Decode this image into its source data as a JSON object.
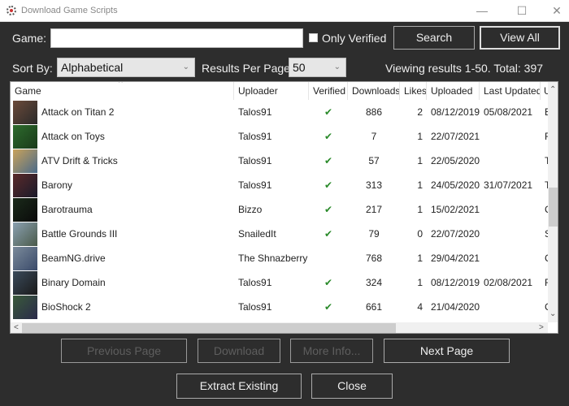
{
  "window": {
    "title": "Download Game Scripts",
    "controls": {
      "minimize": "—",
      "maximize": "☐",
      "close": "✕"
    }
  },
  "search": {
    "game_label": "Game:",
    "game_value": "",
    "only_verified_label": "Only Verified",
    "only_verified_checked": false,
    "search_button": "Search",
    "view_all_button": "View All"
  },
  "sort": {
    "label": "Sort By:",
    "value": "Alphabetical",
    "per_page_label": "Results Per Page:",
    "per_page_value": "50",
    "status": "Viewing results 1-50. Total: 397"
  },
  "table": {
    "columns": [
      "Game",
      "Uploader",
      "Verified",
      "Downloads",
      "Likes",
      "Uploaded",
      "Last Updated",
      "U"
    ],
    "sort_column": "Game",
    "check_glyph": "✔",
    "rows": [
      {
        "game": "Attack on Titan 2",
        "uploader": "Talos91",
        "verified": true,
        "downloads": "886",
        "likes": "2",
        "uploaded": "08/12/2019",
        "updated": "05/08/2021",
        "extra": "E",
        "thumb": [
          "#6b4a3a",
          "#2a2a2a"
        ]
      },
      {
        "game": "Attack on Toys",
        "uploader": "Talos91",
        "verified": true,
        "downloads": "7",
        "likes": "1",
        "uploaded": "22/07/2021",
        "updated": "",
        "extra": "F",
        "thumb": [
          "#2d6b2d",
          "#1a3a1a"
        ]
      },
      {
        "game": "ATV Drift & Tricks",
        "uploader": "Talos91",
        "verified": true,
        "downloads": "57",
        "likes": "1",
        "uploaded": "22/05/2020",
        "updated": "",
        "extra": "T",
        "thumb": [
          "#c9a25a",
          "#4a6a8a"
        ]
      },
      {
        "game": "Barony",
        "uploader": "Talos91",
        "verified": true,
        "downloads": "313",
        "likes": "1",
        "uploaded": "24/05/2020",
        "updated": "31/07/2021",
        "extra": "T",
        "thumb": [
          "#5a2a2a",
          "#1a1a2a"
        ]
      },
      {
        "game": "Barotrauma",
        "uploader": "Bizzo",
        "verified": true,
        "downloads": "217",
        "likes": "1",
        "uploaded": "15/02/2021",
        "updated": "",
        "extra": "C",
        "thumb": [
          "#1a2a1a",
          "#0a0a0a"
        ]
      },
      {
        "game": "Battle Grounds III",
        "uploader": "SnailedIt",
        "verified": true,
        "downloads": "79",
        "likes": "0",
        "uploaded": "22/07/2020",
        "updated": "",
        "extra": "S",
        "thumb": [
          "#8aa0b0",
          "#4a5a4a"
        ]
      },
      {
        "game": "BeamNG.drive",
        "uploader": "The Shnazberry",
        "verified": false,
        "downloads": "768",
        "likes": "1",
        "uploaded": "29/04/2021",
        "updated": "",
        "extra": "C",
        "thumb": [
          "#7a8a9a",
          "#3a4a6a"
        ]
      },
      {
        "game": "Binary Domain",
        "uploader": "Talos91",
        "verified": true,
        "downloads": "324",
        "likes": "1",
        "uploaded": "08/12/2019",
        "updated": "02/08/2021",
        "extra": "F",
        "thumb": [
          "#3a4a5a",
          "#1a1a1a"
        ]
      },
      {
        "game": "BioShock 2",
        "uploader": "Talos91",
        "verified": true,
        "downloads": "661",
        "likes": "4",
        "uploaded": "21/04/2020",
        "updated": "",
        "extra": "C",
        "thumb": [
          "#3a5a3a",
          "#2a2a4a"
        ]
      }
    ]
  },
  "buttons": {
    "previous_page": "Previous Page",
    "download": "Download",
    "more_info": "More Info...",
    "next_page": "Next Page",
    "extract_existing": "Extract Existing",
    "close": "Close"
  },
  "scroll": {
    "up": "⌃",
    "down": "⌄",
    "left": "<",
    "right": ">",
    "dropdown": "⌄"
  }
}
